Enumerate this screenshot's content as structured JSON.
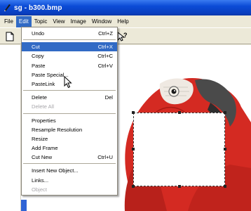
{
  "window": {
    "title": "sg - b300.bmp"
  },
  "menubar": {
    "items": [
      "File",
      "Edit",
      "Topic",
      "View",
      "Image",
      "Window",
      "Help"
    ],
    "active": "Edit"
  },
  "toolbar": {
    "buttons": [
      "new-document-icon",
      "help-pointer-icon"
    ]
  },
  "edit_menu": {
    "items": [
      {
        "label": "Undo",
        "shortcut": "Ctrl+Z",
        "state": "normal"
      },
      {
        "separator": true
      },
      {
        "label": "Cut",
        "shortcut": "Ctrl+X",
        "state": "selected"
      },
      {
        "label": "Copy",
        "shortcut": "Ctrl+C",
        "state": "normal"
      },
      {
        "label": "Paste",
        "shortcut": "Ctrl+V",
        "state": "normal"
      },
      {
        "label": "Paste Special...",
        "shortcut": "",
        "state": "normal"
      },
      {
        "label": "PasteLink",
        "shortcut": "",
        "state": "normal"
      },
      {
        "separator": true
      },
      {
        "label": "Delete",
        "shortcut": "Del",
        "state": "normal"
      },
      {
        "label": "Delete All",
        "shortcut": "",
        "state": "disabled"
      },
      {
        "separator": true
      },
      {
        "label": "Properties",
        "shortcut": "",
        "state": "normal"
      },
      {
        "label": "Resample Resolution",
        "shortcut": "",
        "state": "normal"
      },
      {
        "label": "Resize",
        "shortcut": "",
        "state": "normal"
      },
      {
        "label": "Add Frame",
        "shortcut": "",
        "state": "normal"
      },
      {
        "label": "Cut New",
        "shortcut": "Ctrl+U",
        "state": "normal"
      },
      {
        "separator": true
      },
      {
        "label": "Insert New Object...",
        "shortcut": "",
        "state": "normal"
      },
      {
        "label": "Links...",
        "shortcut": "",
        "state": "normal"
      },
      {
        "label": "Object",
        "shortcut": "",
        "state": "disabled"
      }
    ]
  },
  "colors": {
    "title_bar": "#0b4bd6",
    "menu_highlight": "#316ac5",
    "parrot_red": "#d42a22",
    "parrot_beak": "#4a4a4a",
    "selection_fill": "#ffffff"
  }
}
